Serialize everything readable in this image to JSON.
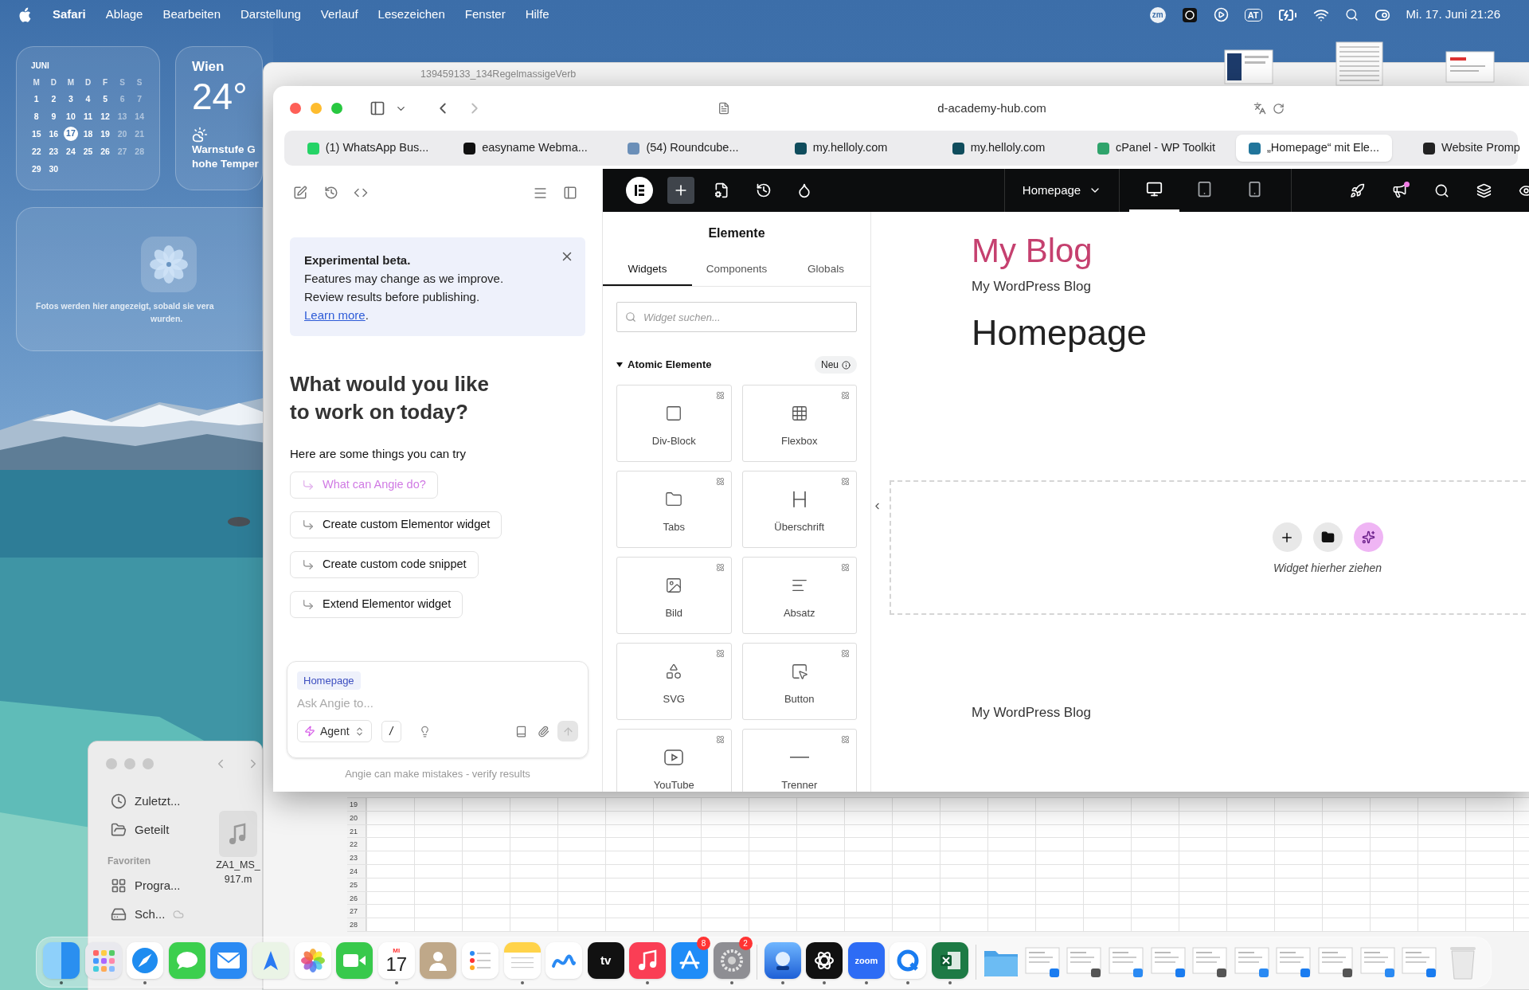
{
  "menu_bar": {
    "app": "Safari",
    "menus": [
      "Ablage",
      "Bearbeiten",
      "Darstellung",
      "Verlauf",
      "Lesezeichen",
      "Fenster",
      "Hilfe"
    ],
    "status_badge": "zm",
    "input_source": "AT",
    "clock": "Mi. 17. Juni 21:26"
  },
  "calendar_widget": {
    "month": "JUNI",
    "weekdays": [
      "M",
      "D",
      "M",
      "D",
      "F",
      "S",
      "S"
    ],
    "weeks": [
      [
        {
          "label": "1",
          "selected": false
        },
        {
          "label": "2",
          "selected": false
        },
        {
          "label": "3",
          "selected": false
        },
        {
          "label": "4",
          "selected": false
        },
        {
          "label": "5",
          "selected": false
        },
        {
          "label": "6",
          "selected": false
        },
        {
          "label": "7",
          "selected": false
        }
      ],
      [
        {
          "label": "8",
          "selected": false
        },
        {
          "label": "9",
          "selected": false
        },
        {
          "label": "10",
          "selected": false
        },
        {
          "label": "11",
          "selected": false
        },
        {
          "label": "12",
          "selected": false
        },
        {
          "label": "13",
          "selected": false
        },
        {
          "label": "14",
          "selected": false
        }
      ],
      [
        {
          "label": "15",
          "selected": false
        },
        {
          "label": "16",
          "selected": false
        },
        {
          "label": "17",
          "selected": true
        },
        {
          "label": "18",
          "selected": false
        },
        {
          "label": "19",
          "selected": false
        },
        {
          "label": "20",
          "selected": false
        },
        {
          "label": "21",
          "selected": false
        }
      ],
      [
        {
          "label": "22",
          "selected": false
        },
        {
          "label": "23",
          "selected": false
        },
        {
          "label": "24",
          "selected": false
        },
        {
          "label": "25",
          "selected": false
        },
        {
          "label": "26",
          "selected": false
        },
        {
          "label": "27",
          "selected": false
        },
        {
          "label": "28",
          "selected": false
        }
      ],
      [
        {
          "label": "29",
          "selected": false
        },
        {
          "label": "30",
          "selected": false
        }
      ]
    ]
  },
  "weather_widget": {
    "city": "Wien",
    "temperature": "24°",
    "lines": [
      "Warnstufe G",
      "hohe Temper"
    ]
  },
  "photos_widget": {
    "lines": [
      "Fotos werden hier angezeigt, sobald sie vera",
      "wurden."
    ]
  },
  "finder_window": {
    "sidebar": [
      {
        "kind": "item",
        "label": "Zuletzt..."
      },
      {
        "kind": "item",
        "label": "Geteilt"
      },
      {
        "kind": "header",
        "label": "Favoriten"
      },
      {
        "kind": "item",
        "label": "Progra..."
      },
      {
        "kind": "item",
        "label": "Sch..."
      }
    ],
    "file_name_lines": [
      "ZA1_MS_",
      "917.m"
    ]
  },
  "spreadsheet_window": {
    "title": "139459133_134RegelmassigeVerb",
    "row_numbers": [
      "19",
      "20",
      "21",
      "22",
      "23",
      "24",
      "25",
      "26",
      "27",
      "28"
    ]
  },
  "safari": {
    "url": "d-academy-hub.com",
    "tabs": [
      {
        "title": "(1) WhatsApp Bus...",
        "selected": false
      },
      {
        "title": "easyname Webma...",
        "selected": false
      },
      {
        "title": "(54) Roundcube...",
        "selected": false
      },
      {
        "title": "my.helloly.com",
        "selected": false
      },
      {
        "title": "my.helloly.com",
        "selected": false
      },
      {
        "title": "cPanel - WP Toolkit",
        "selected": false
      },
      {
        "title": "„Homepage“ mit Ele...",
        "selected": true
      },
      {
        "title": "Website Promp",
        "selected": false
      }
    ]
  },
  "angie": {
    "banner": {
      "title": "Experimental beta.",
      "body": "Features may change as we improve.\nReview results before publishing.",
      "link": "Learn more",
      "link_suffix": "."
    },
    "heading": "What would you like\nto work on today?",
    "subheading": "Here are some things you can try",
    "suggestions": [
      {
        "label": "What can Angie do?",
        "selected": true
      },
      {
        "label": "Create custom Elementor widget",
        "selected": false
      },
      {
        "label": "Create custom code snippet",
        "selected": false
      },
      {
        "label": "Extend Elementor widget",
        "selected": false
      }
    ],
    "composer": {
      "context_chip": "Homepage",
      "placeholder": "Ask Angie to...",
      "mode": "Agent",
      "command": "/"
    },
    "disclaimer": "Angie can make mistakes - verify results"
  },
  "elementor": {
    "toolbar": {
      "add_active": true,
      "page": "Homepage",
      "devices": [
        {
          "selected": true
        },
        {
          "selected": false
        },
        {
          "selected": false
        }
      ],
      "notifications": true
    },
    "panel": {
      "title": "Elemente",
      "tabs": [
        {
          "label": "Widgets",
          "selected": true
        },
        {
          "label": "Components",
          "selected": false
        },
        {
          "label": "Globals",
          "selected": false
        }
      ],
      "search_placeholder": "Widget suchen...",
      "section": {
        "title": "Atomic Elemente",
        "expanded": true,
        "badge": "Neu"
      },
      "widgets": [
        {
          "label": "Div-Block"
        },
        {
          "label": "Flexbox"
        },
        {
          "label": "Tabs"
        },
        {
          "label": "Überschrift"
        },
        {
          "label": "Bild"
        },
        {
          "label": "Absatz"
        },
        {
          "label": "SVG"
        },
        {
          "label": "Button"
        },
        {
          "label": "YouTube"
        },
        {
          "label": "Trenner"
        }
      ]
    },
    "canvas": {
      "site_title": "My Blog",
      "tagline": "My WordPress Blog",
      "page_title": "Homepage",
      "drop_hint": "Widget hierher ziehen",
      "footer": "My WordPress Blog"
    }
  },
  "dock": {
    "apps": [
      {
        "running": true
      },
      {
        "running": false
      },
      {
        "running": true
      },
      {
        "running": false
      },
      {
        "running": false
      },
      {
        "running": false
      },
      {
        "running": false
      },
      {
        "running": false
      },
      {
        "running": true,
        "month": "MI",
        "day": "17"
      },
      {
        "running": false
      },
      {
        "running": false
      },
      {
        "running": true
      },
      {
        "running": false
      },
      {
        "running": false,
        "label": "tv"
      },
      {
        "running": true
      },
      {
        "running": false,
        "badge": "8"
      },
      {
        "running": true,
        "badge": "2"
      },
      {
        "running": true
      },
      {
        "running": true
      },
      {
        "running": true,
        "label": "zoom"
      },
      {
        "running": true
      },
      {
        "running": true
      }
    ]
  }
}
